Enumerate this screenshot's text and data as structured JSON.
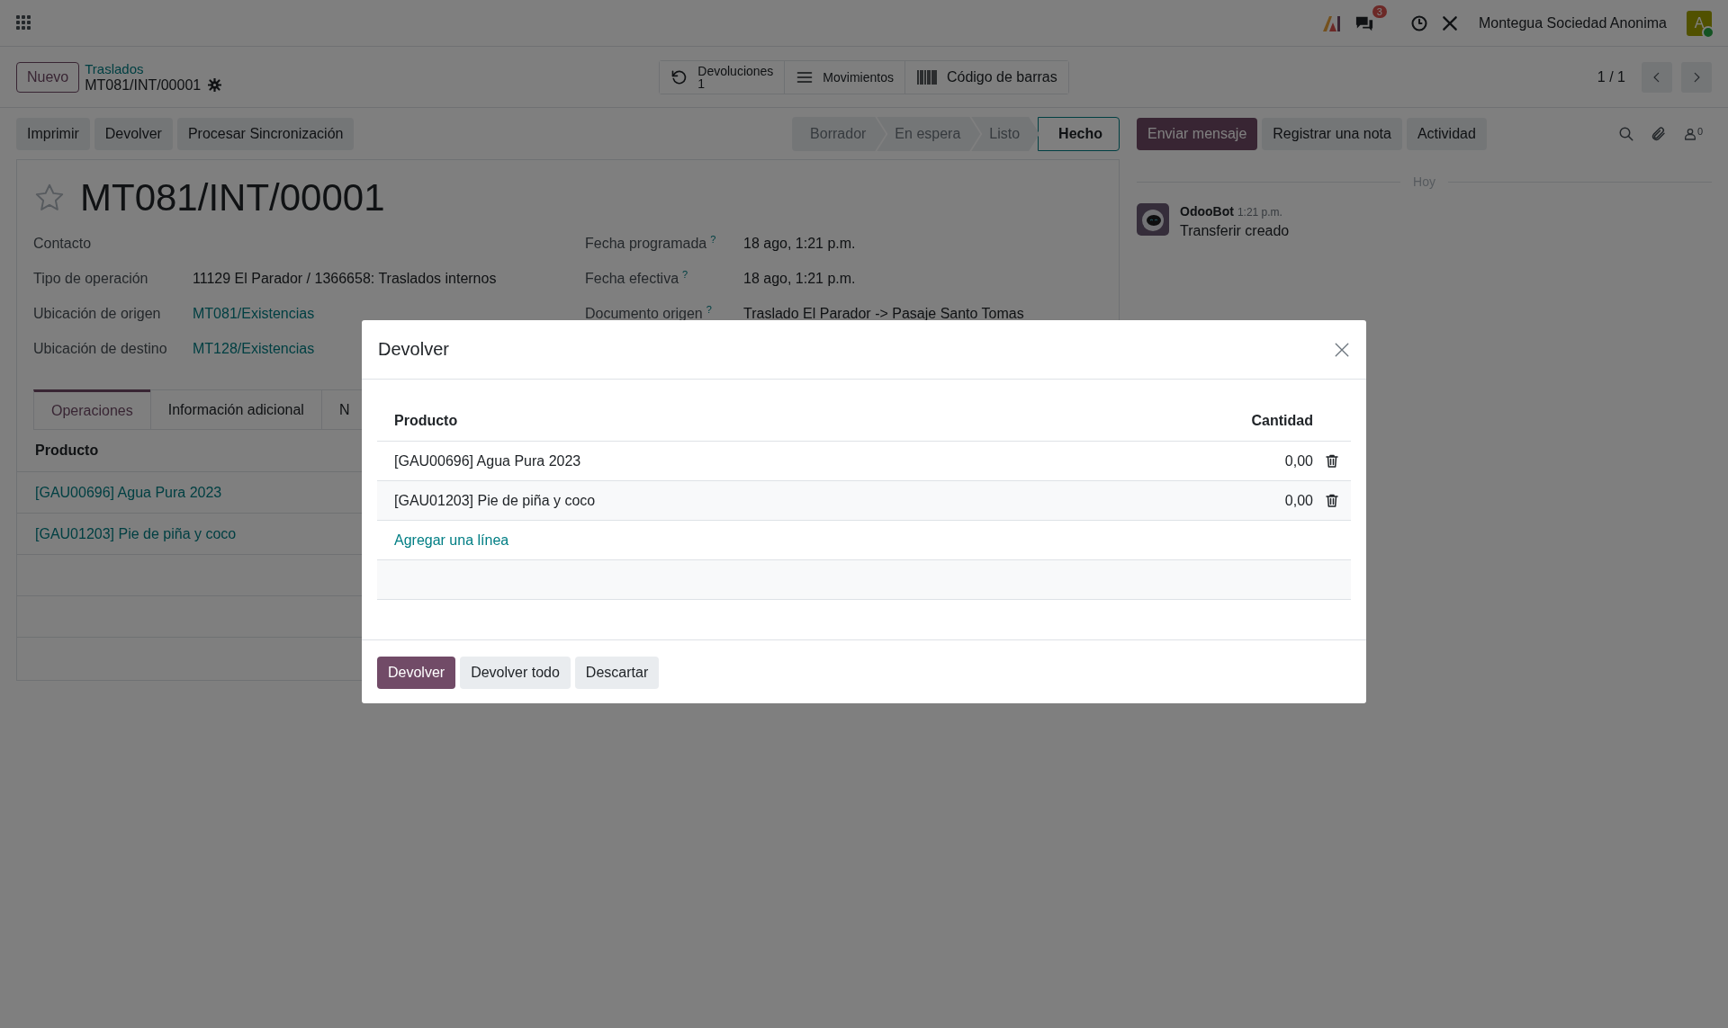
{
  "navbar": {
    "messages_badge": "3",
    "company": "Montegua Sociedad Anonima",
    "avatar_letter": "A"
  },
  "control_panel": {
    "new_button": "Nuevo",
    "breadcrumb": "Traslados",
    "record": "MT081/INT/00001",
    "smart_buttons": [
      {
        "kind": "returns",
        "label": "Devoluciones",
        "count": "1"
      },
      {
        "kind": "moves",
        "label": "Movimientos"
      },
      {
        "kind": "barcode",
        "label": "Código de barras"
      }
    ],
    "pager": "1 / 1"
  },
  "actions": [
    "Imprimir",
    "Devolver",
    "Procesar Sincronización"
  ],
  "statusbar": [
    {
      "label": "Borrador",
      "selected": false
    },
    {
      "label": "En espera",
      "selected": false
    },
    {
      "label": "Listo",
      "selected": false
    },
    {
      "label": "Hecho",
      "selected": true
    }
  ],
  "form": {
    "title": "MT081/INT/00001",
    "starred": false,
    "fields_left": [
      {
        "label": "Contacto"
      },
      {
        "label": "Tipo de operación",
        "value": "11129 El Parador / 1366658: Traslados internos",
        "kind": "text"
      },
      {
        "label": "Ubicación de origen",
        "value": "MT081/Existencias",
        "kind": "link"
      },
      {
        "label": "Ubicación de destino",
        "value": "MT128/Existencias",
        "kind": "link"
      }
    ],
    "fields_right": [
      {
        "label": "Fecha programada",
        "help": "?",
        "value": "18 ago, 1:21 p.m."
      },
      {
        "label": "Fecha efectiva",
        "help": "?",
        "value": "18 ago, 1:21 p.m."
      },
      {
        "label": "Documento origen",
        "help": "?",
        "value": "Traslado El Parador -> Pasaje Santo Tomas"
      }
    ],
    "tabs": [
      {
        "label": "Operaciones",
        "selected": true
      },
      {
        "label": "Información adicional",
        "selected": false
      },
      {
        "label": "N",
        "selected": false
      }
    ],
    "table": {
      "column": "Producto",
      "rows": [
        "[GAU00696] Agua Pura 2023",
        "[GAU01203] Pie de piña y coco"
      ]
    }
  },
  "chatter": {
    "buttons": [
      {
        "label": "Enviar mensaje",
        "primary": true
      },
      {
        "label": "Registrar una nota",
        "primary": false
      },
      {
        "label": "Actividad",
        "primary": false
      }
    ],
    "followers_count": "0",
    "day": "Hoy",
    "messages": [
      {
        "author": "OdooBot",
        "time": "1:21 p.m.",
        "body": "Transferir creado"
      }
    ]
  },
  "dialog": {
    "title": "Devolver",
    "columns": [
      "Producto",
      "Cantidad"
    ],
    "lines": [
      {
        "product": "[GAU00696] Agua Pura 2023",
        "quantity": "0,00"
      },
      {
        "product": "[GAU01203] Pie de piña y coco",
        "quantity": "0,00"
      }
    ],
    "add_line": "Agregar una línea",
    "buttons": [
      {
        "label": "Devolver",
        "primary": true
      },
      {
        "label": "Devolver todo",
        "primary": false
      },
      {
        "label": "Descartar",
        "primary": false
      }
    ]
  }
}
